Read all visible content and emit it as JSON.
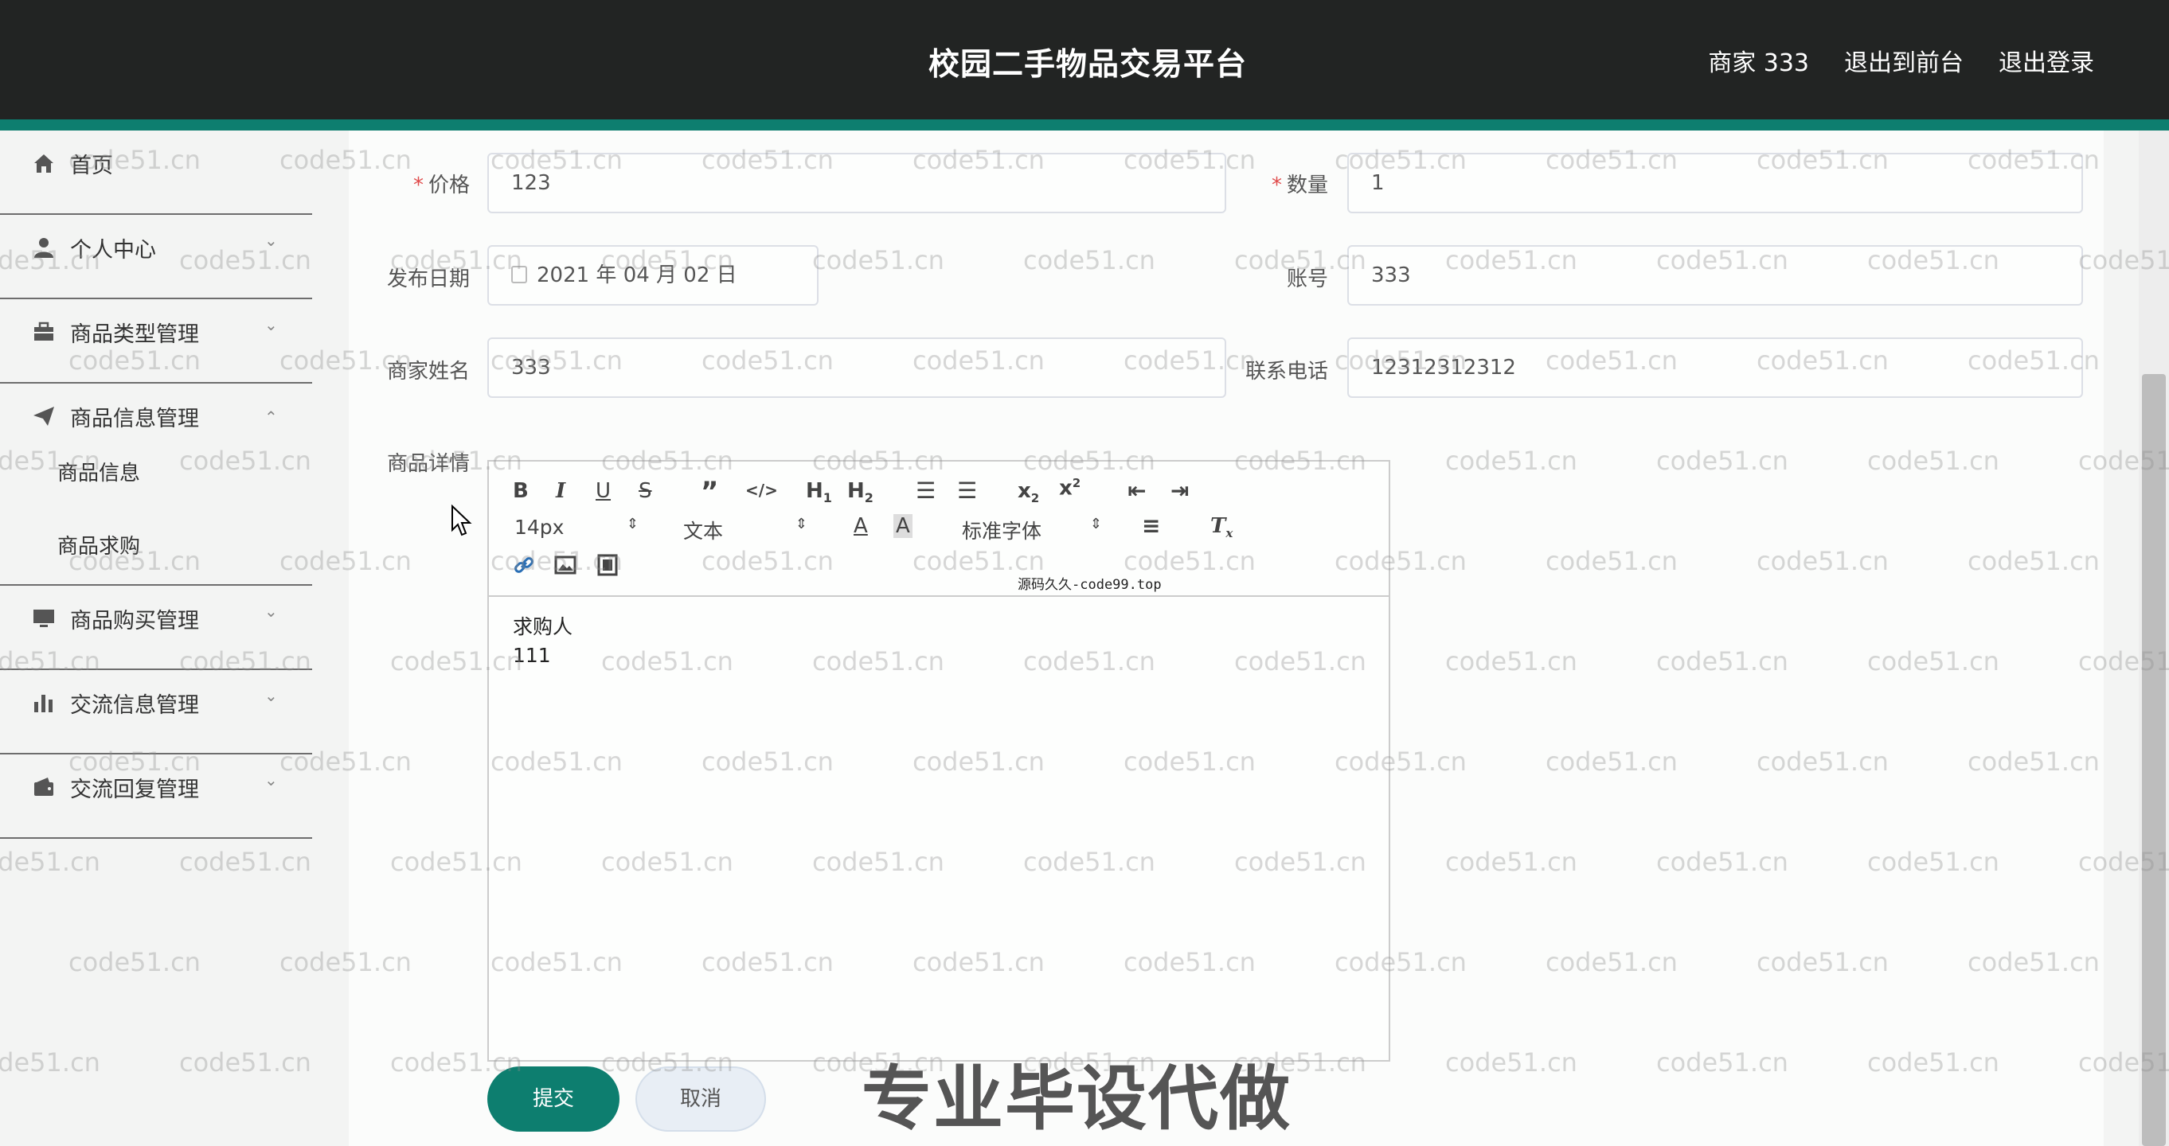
{
  "header": {
    "title": "校园二手物品交易平台",
    "links": [
      "商家 333",
      "退出到前台",
      "退出登录"
    ]
  },
  "sidebar": {
    "items": [
      {
        "label": "首页",
        "icon": "home-icon"
      },
      {
        "label": "个人中心",
        "icon": "user-icon"
      },
      {
        "label": "商品类型管理",
        "icon": "briefcase-icon"
      },
      {
        "label": "商品信息管理",
        "icon": "send-icon"
      },
      {
        "label": "商品购买管理",
        "icon": "monitor-icon"
      },
      {
        "label": "交流信息管理",
        "icon": "bar-chart-icon"
      },
      {
        "label": "交流回复管理",
        "icon": "wallet-icon"
      }
    ],
    "subitems": [
      "商品信息",
      "商品求购"
    ]
  },
  "form": {
    "price": {
      "label": "价格",
      "value": "123"
    },
    "quantity": {
      "label": "数量",
      "value": "1"
    },
    "publish_date": {
      "label": "发布日期",
      "value": "2021 年 04 月 02 日"
    },
    "account": {
      "label": "账号",
      "value": "333"
    },
    "merchant_name": {
      "label": "商家姓名",
      "value": "333"
    },
    "phone": {
      "label": "联系电话",
      "value": "12312312312"
    },
    "detail": {
      "label": "商品详情"
    }
  },
  "editor": {
    "font_size": "14px",
    "text_type": "文本",
    "font_family": "标准字体",
    "content_lines": [
      "求购人",
      "111"
    ]
  },
  "buttons": {
    "submit": "提交",
    "cancel": "取消"
  },
  "overlay": {
    "watermark": "code51.cn",
    "badge": "源码久久-code99.top",
    "promo": "专业毕设代做"
  },
  "colors": {
    "accent": "#0d7e6f",
    "header_bg": "#222423",
    "required": "#e04a4a"
  }
}
